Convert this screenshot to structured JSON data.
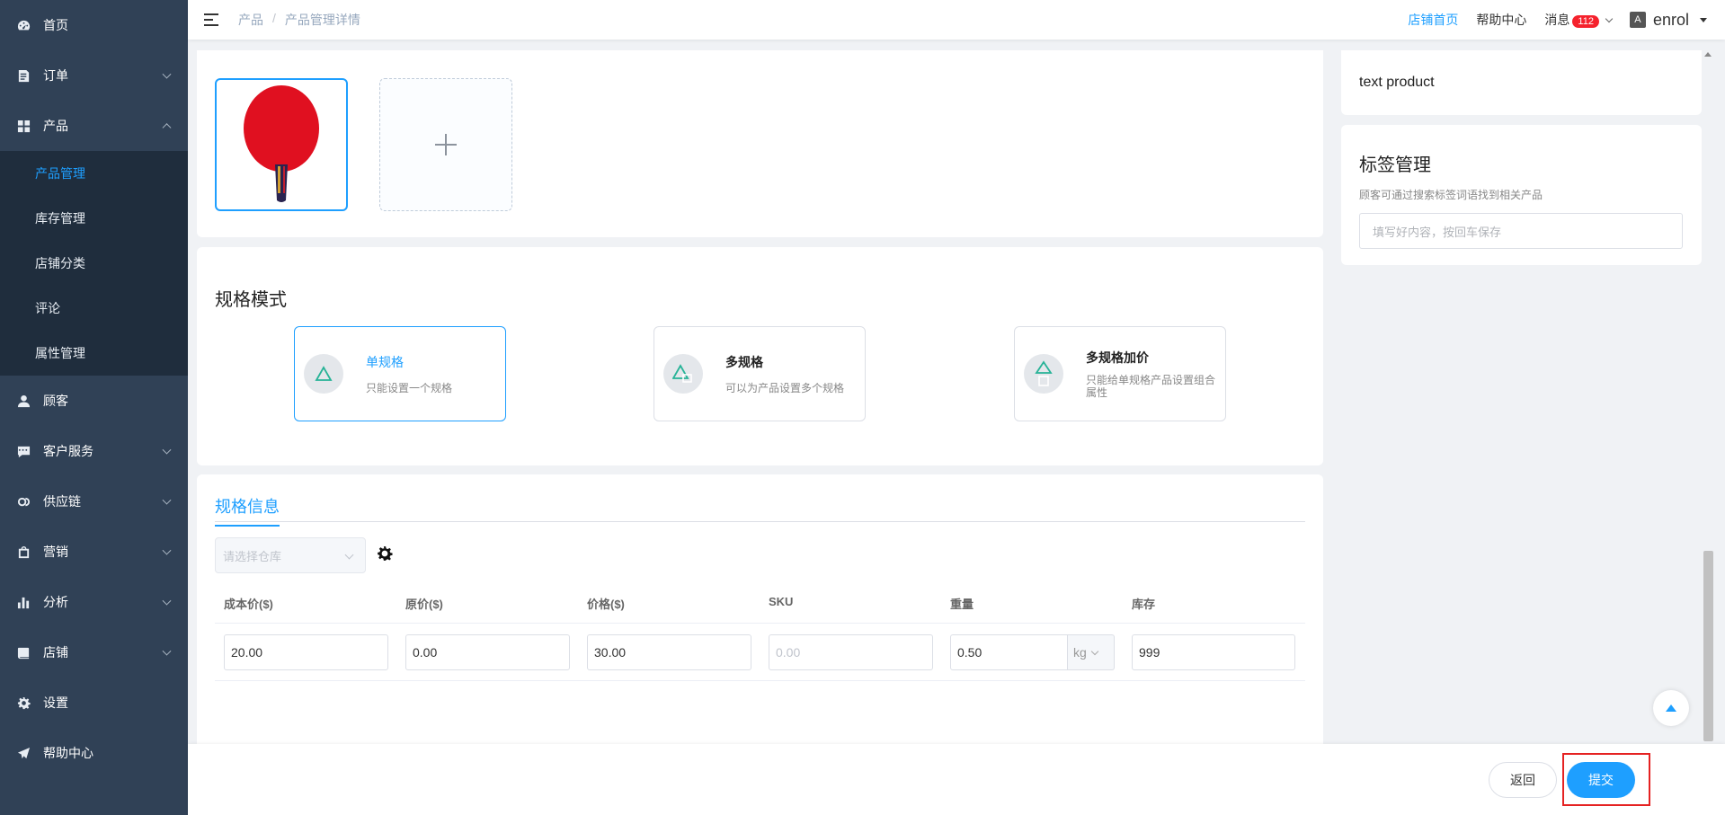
{
  "sidebar": {
    "items": [
      {
        "label": "首页",
        "icon": "dashboard-icon"
      },
      {
        "label": "订单",
        "icon": "order-icon"
      },
      {
        "label": "产品",
        "icon": "grid-icon"
      },
      {
        "label": "顾客",
        "icon": "user-icon"
      },
      {
        "label": "客户服务",
        "icon": "chat-icon"
      },
      {
        "label": "供应链",
        "icon": "link-icon"
      },
      {
        "label": "营销",
        "icon": "bag-icon"
      },
      {
        "label": "分析",
        "icon": "bar-chart-icon"
      },
      {
        "label": "店铺",
        "icon": "store-icon"
      },
      {
        "label": "设置",
        "icon": "gear-icon"
      },
      {
        "label": "帮助中心",
        "icon": "paper-plane-icon"
      }
    ],
    "product_submenu": [
      "产品管理",
      "库存管理",
      "店铺分类",
      "评论",
      "属性管理"
    ]
  },
  "header": {
    "breadcrumb": [
      "产品",
      "产品管理详情"
    ],
    "breadcrumb_sep": "/",
    "store_home": "店铺首页",
    "help_center": "帮助中心",
    "messages": "消息",
    "message_count": "112",
    "lang_icon_text": "A",
    "username": "enrol"
  },
  "spec_mode": {
    "title": "规格模式",
    "options": [
      {
        "name": "单规格",
        "desc": "只能设置一个规格",
        "active": true
      },
      {
        "name": "多规格",
        "desc": "可以为产品设置多个规格",
        "active": false
      },
      {
        "name": "多规格加价",
        "desc": "只能给单规格产品设置组合属性",
        "active": false
      }
    ]
  },
  "spec_info": {
    "tab": "规格信息",
    "warehouse_placeholder": "请选择仓库",
    "columns": [
      "成本价($)",
      "原价($)",
      "价格($)",
      "SKU",
      "重量",
      "库存"
    ],
    "row": {
      "cost": "20.00",
      "original_price": "0.00",
      "price": "30.00",
      "sku": "0.00",
      "weight": "0.50",
      "weight_unit": "kg",
      "stock": "999"
    }
  },
  "right_panel": {
    "product_text": "text product",
    "tags_title": "标签管理",
    "tags_desc": "顾客可通过搜索标签词语找到相关产品",
    "tags_placeholder": "填写好内容，按回车保存"
  },
  "footer": {
    "back": "返回",
    "submit": "提交"
  },
  "colors": {
    "primary": "#1e9fff",
    "sidebar": "#304156",
    "submenu": "#1f2d3d",
    "badge": "#f5222d",
    "highlight_frame": "#e52222"
  }
}
